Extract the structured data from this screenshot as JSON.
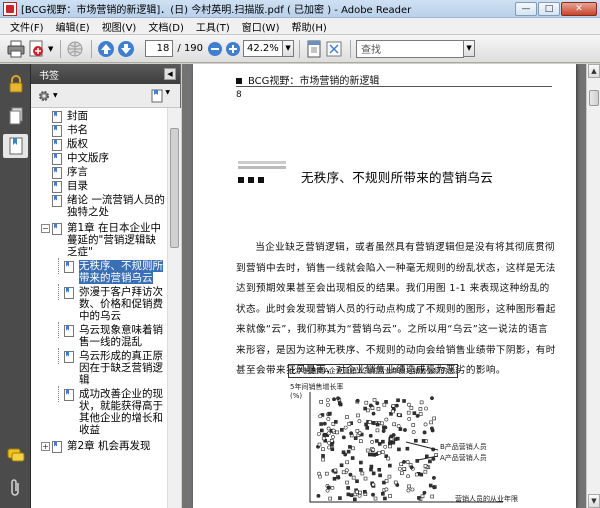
{
  "window": {
    "title": "[BCG视野：市场营销的新逻辑]．(日) 今村英明.扫描版.pdf ( 已加密 ) - Adobe Reader",
    "minimize": "—",
    "maximize": "□",
    "close": "✕"
  },
  "menu": [
    {
      "label": "文件(F)"
    },
    {
      "label": "编辑(E)"
    },
    {
      "label": "视图(V)"
    },
    {
      "label": "文档(D)"
    },
    {
      "label": "工具(T)"
    },
    {
      "label": "窗口(W)"
    },
    {
      "label": "帮助(H)"
    }
  ],
  "toolbar": {
    "page_current": "18",
    "page_total": "/ 190",
    "zoom": "42.2%",
    "search_placeholder": "查找"
  },
  "bookmarks_panel": {
    "title": "书签",
    "items": [
      {
        "label": "封面",
        "level": 1
      },
      {
        "label": "书名",
        "level": 1
      },
      {
        "label": "版权",
        "level": 1
      },
      {
        "label": "中文版序",
        "level": 1
      },
      {
        "label": "序言",
        "level": 1
      },
      {
        "label": "目录",
        "level": 1
      },
      {
        "label": "绪论 一流营销人员的独特之处",
        "level": 1
      },
      {
        "label": "第1章 在日本企业中蔓延的\"营销逻辑缺乏症\"",
        "level": 1,
        "expanded": true
      },
      {
        "label": "无秩序、不规则所带来的营销乌云",
        "level": 2,
        "selected": true
      },
      {
        "label": "弥漫于客户拜访次数、价格和促销费中的乌云",
        "level": 2
      },
      {
        "label": "乌云现象意味着销售一线的混乱",
        "level": 2
      },
      {
        "label": "乌云形成的真正原因在于缺乏营销逻辑",
        "level": 2
      },
      {
        "label": "成功改善企业的现状，就能获得高于其他企业的增长和收益",
        "level": 2
      },
      {
        "label": "第2章 机会再发现",
        "level": 1,
        "expanded": false
      }
    ]
  },
  "document": {
    "running_head": "BCG视野：市场营销的新逻辑",
    "page_number": "8",
    "section_title": "无秩序、不规则所带来的营销乌云",
    "body": "当企业缺乏营销逻辑，或者虽然具有营销逻辑但是没有将其彻底贯彻到营销中去时，销售一线就会陷入一种毫无规则的纷乱状态，这样是无法达到预期效果甚至会出现相反的结果。我们用图 1-1 来表现这种纷乱的状态。此时会发现营销人员的行动点构成了不规则的图形，这种图形看起来就像“云”，我们称其为“营销乌云”。之所以用“乌云”这一说法的语言来形容，是因为这种无秩序、不规则的动向会给销售业绩带下阴影，有时甚至会带来狂风暴雨，对企业销售业绩造成极为恶劣的影响。",
    "figure_title": "化学制造商A企业营销人员的从业年限与销售业绩的关系",
    "figure_ylabel": "5年间销售增长率",
    "figure_yunit": "(%)",
    "legend_b": "B产品营销人员",
    "legend_a": "A产品营销人员",
    "figure_xlabel": "营销人员的从业年限"
  },
  "colors": {
    "accent": "#3b6fb5",
    "rail": "#4b4b4b",
    "doc_background": "#737373"
  }
}
